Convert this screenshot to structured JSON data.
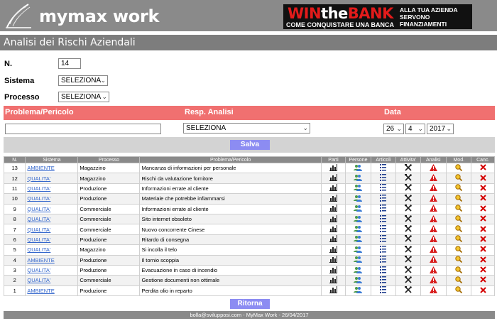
{
  "header": {
    "app_title": "mymax work",
    "ad": {
      "line1_red": "WIN",
      "line1_white": "the",
      "line1_red2": "BANK",
      "line2": "COME CONQUISTARE UNA BANCA",
      "right_text": "ALLA TUA AZIENDA SERVONO FINANZIAMENTI BANCARI?"
    }
  },
  "page": {
    "title": "Analisi dei Rischi Aziendali"
  },
  "form": {
    "n_label": "N.",
    "n_value": "14",
    "sistema_label": "Sistema",
    "sistema_value": "SELEZIONA",
    "processo_label": "Processo",
    "processo_value": "SELEZIONA",
    "problema_header": "Problema/Pericolo",
    "resp_header": "Resp. Analisi",
    "data_header": "Data",
    "problema_value": "",
    "resp_value": "SELEZIONA",
    "day": "26",
    "month": "4",
    "year": "2017",
    "save_label": "Salva"
  },
  "table": {
    "headers": [
      "N.",
      "Sistema",
      "Processo",
      "Problema/Pericolo",
      "Parti",
      "Persone",
      "Articoli",
      "Attivita'",
      "Analisi",
      "Mod.",
      "Canc."
    ],
    "rows": [
      {
        "n": "13",
        "sistema": "AMBIENTE",
        "processo": "Magazzino",
        "problema": "Mancanza di informazioni per personale"
      },
      {
        "n": "12",
        "sistema": "QUALITA'",
        "processo": "Magazzino",
        "problema": "Rischi da valutazione fornitore"
      },
      {
        "n": "11",
        "sistema": "QUALITA'",
        "processo": "Produzione",
        "problema": "Informazioni errate al cliente"
      },
      {
        "n": "10",
        "sistema": "QUALITA'",
        "processo": "Produzione",
        "problema": "Materiale che potrebbe infiammarsi"
      },
      {
        "n": "9",
        "sistema": "QUALITA'",
        "processo": "Commerciale",
        "problema": "Informazioni errate al cliente"
      },
      {
        "n": "8",
        "sistema": "QUALITA'",
        "processo": "Commerciale",
        "problema": "Sito internet obsoleto"
      },
      {
        "n": "7",
        "sistema": "QUALITA'",
        "processo": "Commerciale",
        "problema": "Nuovo concorrente Cinese"
      },
      {
        "n": "6",
        "sistema": "QUALITA'",
        "processo": "Produzione",
        "problema": "Ritardo di consegna"
      },
      {
        "n": "5",
        "sistema": "QUALITA'",
        "processo": "Magazzino",
        "problema": "Si incolla il telo"
      },
      {
        "n": "4",
        "sistema": "AMBIENTE",
        "processo": "Produzione",
        "problema": "Il tornio scoppia"
      },
      {
        "n": "3",
        "sistema": "QUALITA'",
        "processo": "Produzione",
        "problema": "Evacuazione in caso di incendio"
      },
      {
        "n": "2",
        "sistema": "QUALITA'",
        "processo": "Commerciale",
        "problema": "Gestione documenti non ottimale"
      },
      {
        "n": "1",
        "sistema": "AMBIENTE",
        "processo": "Produzione",
        "problema": "Perdita olio in reparto"
      }
    ]
  },
  "ritorna_label": "Ritorna",
  "footer": "bolla@svilupposi.com - MyMax Work - 26/04/2017",
  "icons": {
    "parti": "bar-chart-icon",
    "persone": "people-icon",
    "articoli": "list-icon",
    "attivita": "tools-icon",
    "analisi": "warning-icon",
    "mod": "edit-magnifier-icon",
    "canc": "delete-x-icon"
  },
  "colors": {
    "header_gray": "#8a8a8a",
    "filter_red": "#f07070",
    "button_blue": "#8c8cf2",
    "link_blue": "#3366cc",
    "delete_red": "#d40000"
  }
}
